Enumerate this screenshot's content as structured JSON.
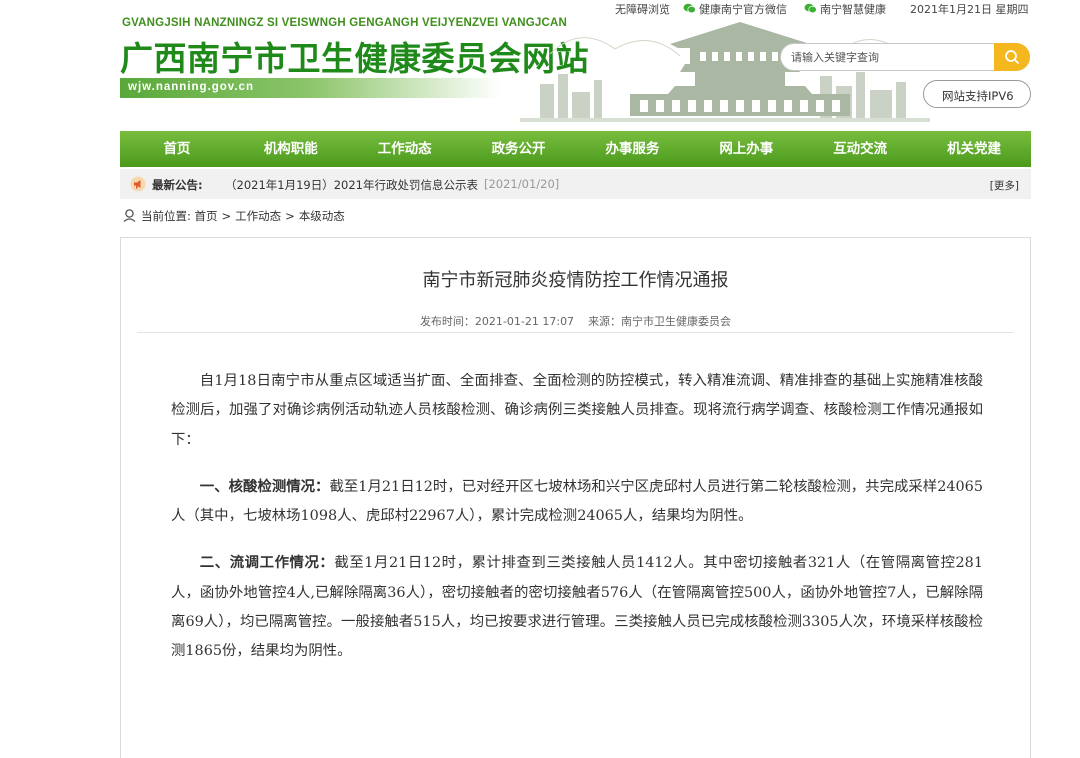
{
  "topbar": {
    "accessibility": "无障碍浏览",
    "wechat_official": "健康南宁官方微信",
    "smart_health": "南宁智慧健康",
    "date": "2021年1月21日 星期四"
  },
  "header": {
    "pinyin": "GVANGJSIH NANZNINGZ SI VEISWNGH GENGANGH VEIJYENZVEI VANGJCAN",
    "site_title": "广西南宁市卫生健康委员会网站",
    "domain": "wjw.nanning.gov.cn",
    "search_placeholder": "请输入关键字查询",
    "ipv6_label": "网站支持IPV6"
  },
  "nav": {
    "items": [
      "首页",
      "机构职能",
      "工作动态",
      "政务公开",
      "办事服务",
      "网上办事",
      "互动交流",
      "机关党建"
    ]
  },
  "notice": {
    "label": "最新公告:",
    "text": "（2021年1月19日）2021年行政处罚信息公示表",
    "date": "[2021/01/20]",
    "more": "[更多]"
  },
  "breadcrumb": {
    "prefix": "当前位置:",
    "items": [
      "首页",
      "工作动态",
      "本级动态"
    ],
    "separator": ">"
  },
  "article": {
    "title": "南宁市新冠肺炎疫情防控工作情况通报",
    "publish_time": "发布时间：2021-01-21 17:07",
    "source": "来源：南宁市卫生健康委员会",
    "paragraphs": [
      {
        "heading": "",
        "text": "自1月18日南宁市从重点区域适当扩面、全面排查、全面检测的防控模式，转入精准流调、精准排查的基础上实施精准核酸检测后，加强了对确诊病例活动轨迹人员核酸检测、确诊病例三类接触人员排查。现将流行病学调查、核酸检测工作情况通报如下："
      },
      {
        "heading": "一、核酸检测情况：",
        "text": "截至1月21日12时，已对经开区七坡林场和兴宁区虎邱村人员进行第二轮核酸检测，共完成采样24065人（其中，七坡林场1098人、虎邱村22967人），累计完成检测24065人，结果均为阴性。"
      },
      {
        "heading": "二、流调工作情况：",
        "text": "截至1月21日12时，累计排查到三类接触人员1412人。其中密切接触者321人（在管隔离管控281人，函协外地管控4人,已解除隔离36人），密切接触者的密切接触者576人（在管隔离管控500人，函协外地管控7人，已解除隔离69人），均已隔离管控。一般接触者515人，均已按要求进行管理。三类接触人员已完成核酸检测3305人次，环境采样核酸检测1865份，结果均为阴性。"
      }
    ]
  },
  "colors": {
    "brand_green": "#1f8a1a",
    "nav_green": "#5aa82a",
    "search_button": "#f4b81e"
  }
}
